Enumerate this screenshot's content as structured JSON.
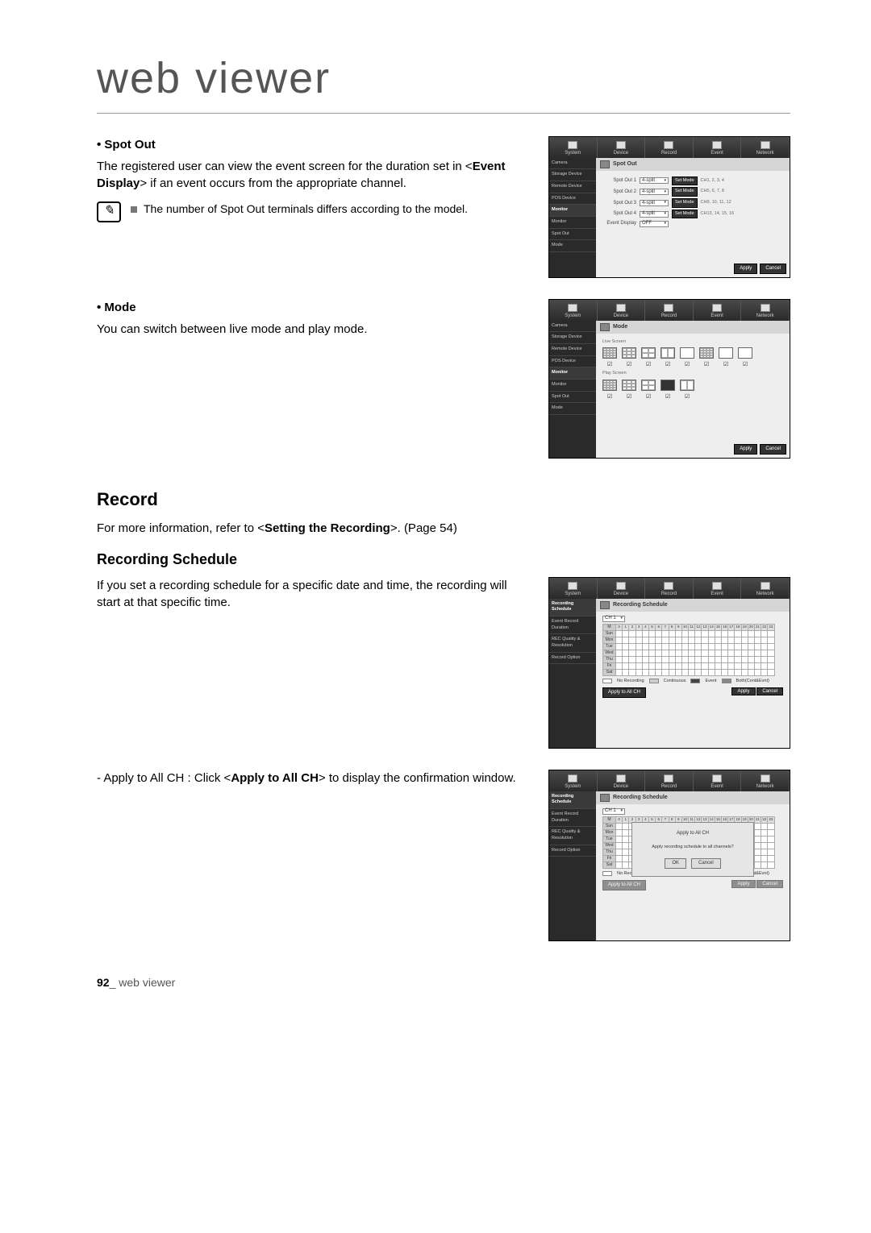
{
  "page": {
    "title": "web viewer",
    "page_number": "92",
    "footer_text": "web viewer"
  },
  "spot_out": {
    "heading": "• Spot Out",
    "para_before": "The registered user can view the event screen for the duration set in <",
    "para_bold": "Event Display",
    "para_after": "> if an event occurs from the appropriate channel.",
    "note": "The number of Spot Out terminals differs according to the model."
  },
  "mode": {
    "heading": "• Mode",
    "para": "You can switch between live mode and play mode."
  },
  "record": {
    "heading": "Record",
    "para_before": "For more information, refer to <",
    "para_bold": "Setting the Recording",
    "para_after": ">. (Page 54)"
  },
  "schedule": {
    "heading": "Recording Schedule",
    "para": "If you set a recording schedule for a specific date and time, the recording will start at that specific time.",
    "apply_before": "- Apply to All CH : Click <",
    "apply_bold": "Apply to All CH",
    "apply_after": "> to display the confirmation window."
  },
  "ui": {
    "tabs": [
      "System",
      "Device",
      "Record",
      "Event",
      "Network"
    ],
    "device_sidebar": [
      "Camera",
      "Storage Device",
      "Remote Device",
      "POS Device",
      "Monitor",
      "Monitor",
      "Spot Out",
      "Mode"
    ],
    "record_sidebar": [
      "Recording Schedule",
      "Event Record Duration",
      "REC Quality & Resolution",
      "Record Option"
    ],
    "spot_out_panel": {
      "title": "Spot Out",
      "rows": [
        {
          "label": "Spot Out 1",
          "value": "4-split",
          "channels": "CH1, 2, 3, 4"
        },
        {
          "label": "Spot Out 2",
          "value": "4-split",
          "channels": "CH5, 6, 7, 8"
        },
        {
          "label": "Spot Out 3",
          "value": "4-split",
          "channels": "CH9, 10, 11, 12"
        },
        {
          "label": "Spot Out 4",
          "value": "4-split",
          "channels": "CH13, 14, 15, 16"
        }
      ],
      "event_label": "Event Display",
      "event_value": "OFF",
      "setmode_btn": "Set Mode"
    },
    "mode_panel": {
      "title": "Mode",
      "live_label": "Live Screen",
      "play_label": "Play Screen"
    },
    "sched_panel": {
      "title": "Recording Schedule",
      "ch_label": "CH 1",
      "days": [
        "M",
        "Sun",
        "Mon",
        "Tue",
        "Wed",
        "Thu",
        "Fri",
        "Sat"
      ],
      "hours": [
        "0",
        "1",
        "2",
        "3",
        "4",
        "5",
        "6",
        "7",
        "8",
        "9",
        "10",
        "11",
        "12",
        "13",
        "14",
        "15",
        "16",
        "17",
        "18",
        "19",
        "20",
        "21",
        "22",
        "23"
      ],
      "legend": {
        "none": "No Recording",
        "cont": "Continuous",
        "event": "Event",
        "both": "Both(Cont&Evnt)"
      },
      "apply_all": "Apply to All CH"
    },
    "dialog": {
      "title": "Apply to All CH",
      "msg": "Apply recording schedule to all channels?",
      "ok": "OK",
      "cancel": "Cancel"
    },
    "btn_apply": "Apply",
    "btn_cancel": "Cancel"
  }
}
